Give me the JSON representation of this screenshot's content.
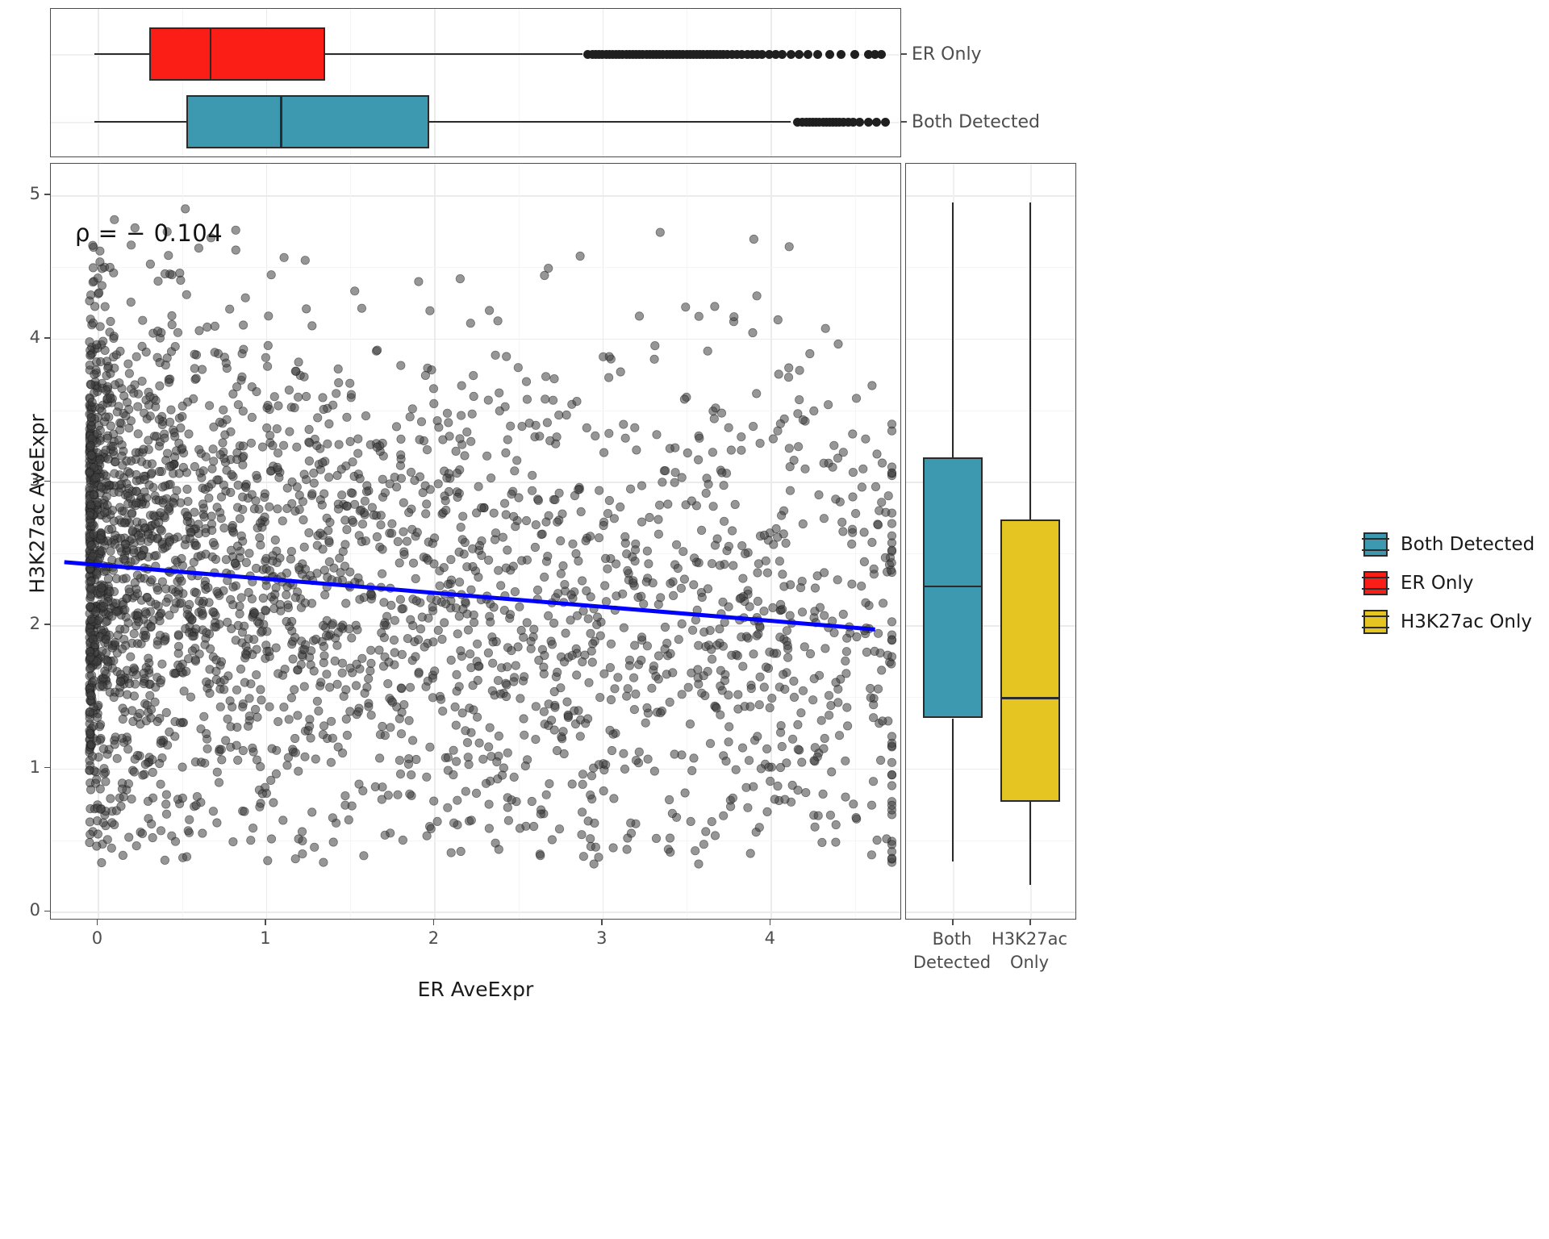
{
  "figure": {
    "annotation_rho": "ρ = − 0.104",
    "x_axis_title": "ER AveExpr",
    "y_axis_title": "H3K27ac AveExpr",
    "x_ticks": [
      "0",
      "1",
      "2",
      "3",
      "4"
    ],
    "y_ticks": [
      "0",
      "1",
      "2",
      "3",
      "4",
      "5"
    ],
    "top_strip_labels": [
      "ER Only",
      "Both Detected"
    ],
    "right_axis_labels": [
      "Both\nDetected",
      "H3K27ac\nOnly"
    ],
    "right_axis_label_1_line1": "Both",
    "right_axis_label_1_line2": "Detected",
    "right_axis_label_2_line1": "H3K27ac",
    "right_axis_label_2_line2": "Only"
  },
  "legend": {
    "title": "",
    "items": [
      {
        "label": "Both Detected",
        "color": "#3C99B0"
      },
      {
        "label": "ER Only",
        "color": "#FA1E17"
      },
      {
        "label": "H3K27ac Only",
        "color": "#E5C522"
      }
    ]
  },
  "colors": {
    "both_detected": "#3C99B0",
    "er_only": "#FA1E17",
    "h3k27ac_only": "#E5C522",
    "regression_line": "#0000FF",
    "point": "#3f3f3f",
    "grid": "#ebebeb",
    "panel_border": "#4d4d4d"
  },
  "chart_data": {
    "type": "scatter",
    "title": "",
    "xlabel": "ER AveExpr",
    "ylabel": "H3K27ac AveExpr",
    "xlim": [
      -0.28,
      4.78
    ],
    "ylim": [
      -0.06,
      5.22
    ],
    "xticks": [
      0,
      1,
      2,
      3,
      4
    ],
    "yticks": [
      0,
      1,
      2,
      3,
      4,
      5
    ],
    "grid": true,
    "legend_position": "right",
    "spearman_rho": -0.104,
    "annotation": "ρ = − 0.104",
    "n_points": 3000,
    "point_color": "#3f3f3f",
    "point_alpha": 0.55,
    "point_size": 9,
    "regression": {
      "type": "linear-fit",
      "color": "#0000FF",
      "width": 5,
      "x_start": -0.2,
      "y_start": 2.44,
      "x_end": 4.62,
      "y_end": 1.97
    },
    "marginal_top": {
      "type": "box",
      "orientation": "horizontal",
      "variable": "ER AveExpr",
      "groups": [
        {
          "name": "ER Only",
          "color": "#FA1E17",
          "whisker_low": -0.02,
          "q1": 0.305,
          "median": 0.67,
          "q3": 1.35,
          "whisker_high": 2.88,
          "n_outliers": 64,
          "outliers": [
            2.91,
            2.94,
            2.96,
            2.98,
            3.0,
            3.02,
            3.04,
            3.06,
            3.08,
            3.1,
            3.12,
            3.14,
            3.16,
            3.18,
            3.2,
            3.22,
            3.24,
            3.26,
            3.28,
            3.3,
            3.32,
            3.34,
            3.36,
            3.38,
            3.4,
            3.42,
            3.44,
            3.46,
            3.48,
            3.5,
            3.52,
            3.54,
            3.56,
            3.58,
            3.6,
            3.62,
            3.64,
            3.66,
            3.68,
            3.7,
            3.72,
            3.74,
            3.77,
            3.8,
            3.83,
            3.86,
            3.89,
            3.92,
            3.95,
            3.99,
            4.03,
            4.07,
            4.12,
            4.17,
            4.22,
            4.28,
            4.35,
            4.42,
            4.5,
            4.58,
            4.62,
            4.66
          ]
        },
        {
          "name": "Both Detected",
          "color": "#3C99B0",
          "whisker_low": -0.02,
          "q1": 0.525,
          "median": 1.09,
          "q3": 1.97,
          "whisker_high": 4.12,
          "n_outliers": 22,
          "outliers": [
            4.16,
            4.19,
            4.21,
            4.23,
            4.25,
            4.27,
            4.29,
            4.31,
            4.33,
            4.35,
            4.37,
            4.39,
            4.41,
            4.43,
            4.46,
            4.49,
            4.53,
            4.58,
            4.63,
            4.68
          ]
        }
      ]
    },
    "marginal_right": {
      "type": "box",
      "orientation": "vertical",
      "variable": "H3K27ac AveExpr",
      "groups": [
        {
          "name": "Both Detected",
          "color": "#3C99B0",
          "whisker_low": 0.35,
          "q1": 1.35,
          "median": 2.27,
          "q3": 3.17,
          "whisker_high": 4.95,
          "n_outliers": 0
        },
        {
          "name": "H3K27ac Only",
          "color": "#E5C522",
          "whisker_low": 0.19,
          "q1": 0.77,
          "median": 1.49,
          "q3": 2.74,
          "whisker_high": 4.95,
          "n_outliers": 0
        }
      ]
    }
  }
}
